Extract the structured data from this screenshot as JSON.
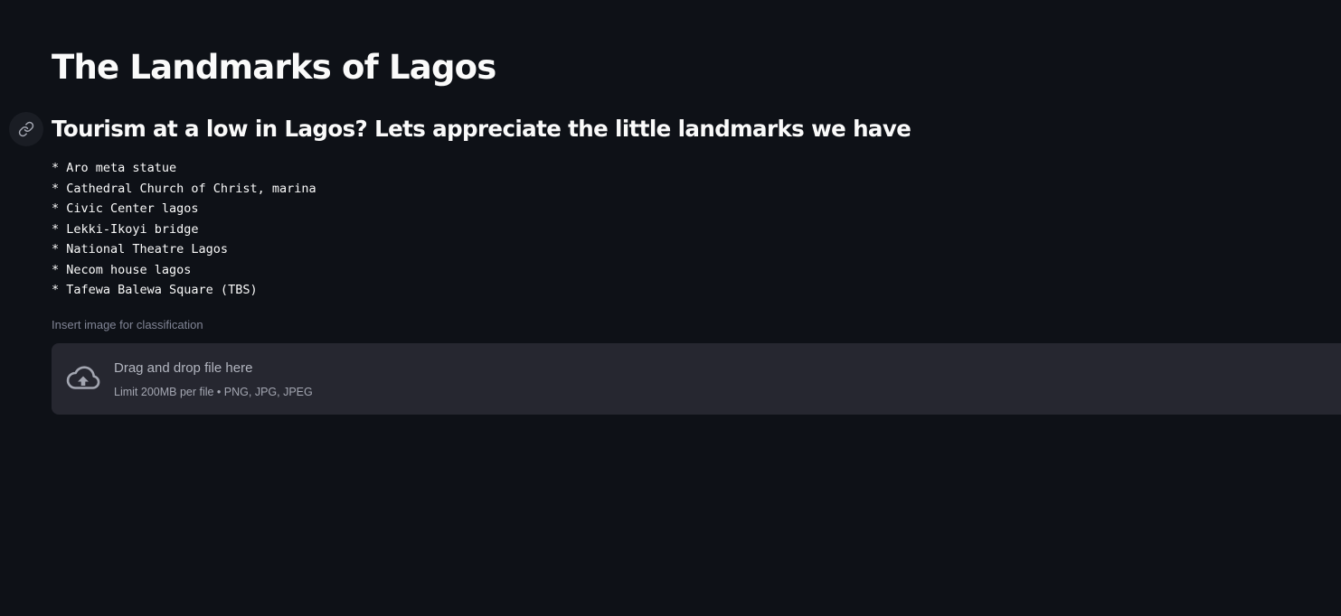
{
  "header": {
    "title": "The Landmarks of Lagos",
    "subtitle": "Tourism at a low in Lagos? Lets appreciate the little landmarks we have"
  },
  "landmarks": [
    "* Aro meta statue",
    "* Cathedral Church of Christ, marina",
    "* Civic Center lagos",
    "* Lekki-Ikoyi bridge",
    "* National Theatre Lagos",
    "* Necom house lagos",
    "* Tafewa Balewa Square (TBS)"
  ],
  "uploader": {
    "label": "Insert image for classification",
    "drop_text": "Drag and drop file here",
    "limit_text": "Limit 200MB per file • PNG, JPG, JPEG",
    "icon": "cloud-upload-icon"
  },
  "anchor": {
    "icon": "link-icon"
  },
  "colors": {
    "background": "#0e1117",
    "text": "#fafafa",
    "muted": "#808495",
    "dropzone": "#262730"
  }
}
